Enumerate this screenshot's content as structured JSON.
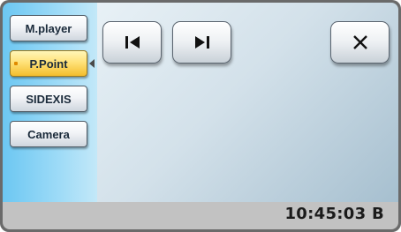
{
  "sidebar": {
    "items": [
      {
        "label": "M.player",
        "active": false
      },
      {
        "label": "P.Point",
        "active": true
      },
      {
        "label": "SIDEXIS",
        "active": false
      },
      {
        "label": "Camera",
        "active": false
      }
    ]
  },
  "controls": {
    "previous": "skip-previous-icon",
    "next": "skip-next-icon",
    "close": "close-icon"
  },
  "status_bar": {
    "clock": "10:45:03  B"
  },
  "colors": {
    "sidebar": "#9edbf7",
    "active_item": "#ffe27a",
    "status_bar": "#c2c2c2"
  }
}
